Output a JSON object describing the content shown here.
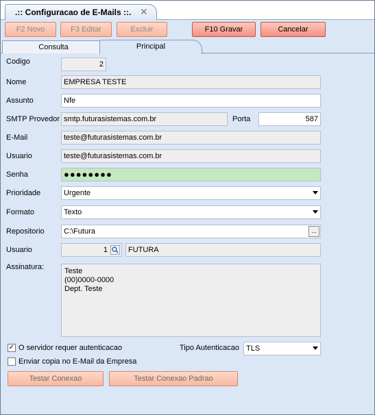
{
  "window": {
    "tab_title": ".:: Configuracao de E-Mails ::.",
    "close_glyph": "✕"
  },
  "toolbar": {
    "novo": "F2 Novo",
    "editar": "F3 Editar",
    "excluir": "Excluir",
    "gravar": "F10 Gravar",
    "cancelar": "Cancelar"
  },
  "tabs": {
    "consulta": "Consulta",
    "principal": "Principal"
  },
  "form": {
    "codigo_label": "Codigo",
    "codigo_value": "2",
    "nome_label": "Nome",
    "nome_value": "EMPRESA TESTE",
    "assunto_label": "Assunto",
    "assunto_value": "Nfe",
    "smtp_label": "SMTP Provedor",
    "smtp_value": "smtp.futurasistemas.com.br",
    "porta_label": "Porta",
    "porta_value": "587",
    "email_label": "E-Mail",
    "email_value": "teste@futurasistemas.com.br",
    "usuario_label": "Usuario",
    "usuario_value": "teste@futurasistemas.com.br",
    "senha_label": "Senha",
    "senha_value": "●●●●●●●●",
    "prioridade_label": "Prioridade",
    "prioridade_value": "Urgente",
    "formato_label": "Formato",
    "formato_value": "Texto",
    "repositorio_label": "Repositorio",
    "repositorio_value": "C:\\Futura",
    "repositorio_button": "...",
    "usuario2_label": "Usuario",
    "usuario2_code": "1",
    "usuario2_name": "FUTURA",
    "assinatura_label": "Assinatura:",
    "assinatura_value": "Teste\n(00)0000-0000\nDept. Teste",
    "auth_required_label": "O servidor requer autenticacao",
    "auth_required_checked": true,
    "auth_check_glyph": "✓",
    "tipo_auth_label": "Tipo Autenticacao",
    "tipo_auth_value": "TLS",
    "copia_label": "Enviar copia no E-Mail da Empresa",
    "copia_checked": false
  },
  "actions": {
    "testar": "Testar Conexao",
    "testar_padrao": "Testar Conexao Padrao"
  },
  "colors": {
    "panel_bg": "#dbe6f6",
    "button_fill": "#f8b8a0",
    "password_bg": "#c4e8c0"
  },
  "icons": {
    "lookup": "magnifier-icon",
    "combo": "dropdown-arrow-icon",
    "check": "checkmark-icon"
  }
}
